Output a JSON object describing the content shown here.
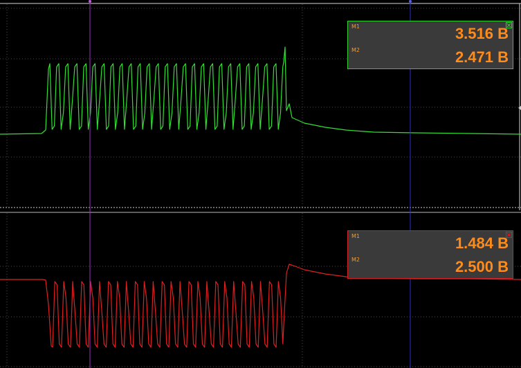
{
  "colors": {
    "background": "#000000",
    "grid": "#3a3a3a",
    "ch1": "#33e033",
    "ch2": "#e02020",
    "cursor_a": "#9b2fc7",
    "cursor_b": "#2a2ad8",
    "readout_text": "#ff8c1a"
  },
  "channel1": {
    "readout": {
      "m1_tag": "M1",
      "m1_value": "3.516 B",
      "m2_tag": "M2",
      "m2_value": "2.471 B"
    }
  },
  "channel2": {
    "readout": {
      "m1_tag": "M1",
      "m1_value": "1.484 B",
      "m2_tag": "M2",
      "m2_value": "2.500 B"
    }
  }
}
